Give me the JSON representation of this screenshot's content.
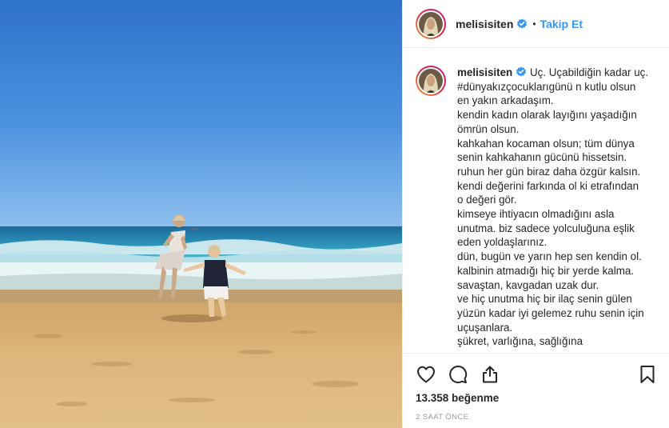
{
  "post": {
    "username": "melisisiten",
    "separator": "•",
    "follow_label": "Takip Et",
    "caption_lines": [
      "Uç. Uçabildiğin kadar uç.",
      "#dünyakızçocuklarıgünü n kutlu olsun",
      "en yakın arkadaşım.",
      "kendin kadın olarak layığını yaşadığın",
      "ömrün olsun.",
      "kahkahan kocaman olsun; tüm dünya",
      "senin kahkahanın gücünü hissetsin.",
      "ruhun her gün biraz daha özgür kalsın.",
      "kendi değerini farkında ol ki etrafından",
      "o değeri gör.",
      "kimseye ihtiyacın olmadığını asla",
      "unutma. biz sadece yolculuğuna eşlik",
      "eden yoldaşlarınız.",
      "dün, bugün ve yarın hep sen kendin ol.",
      "kalbinin atmadığı hiç bir yerde kalma.",
      "savaştan, kavgadan uzak dur.",
      "ve hiç unutma hiç bir ilaç senin gülen",
      "yüzün kadar iyi gelemez ruhu senin için",
      "uçuşanlara.",
      "şükret, varlığına, sağlığına"
    ],
    "likes": "13.358 beğenme",
    "timestamp": "2 SAAT ÖNCE"
  },
  "colors": {
    "accent": "#3897f0",
    "verified": "#3897f0",
    "text": "#262626",
    "muted": "#999999"
  },
  "icons": {
    "like": "heart-icon",
    "comment": "comment-icon",
    "share": "share-icon",
    "save": "bookmark-icon",
    "verified": "verified-badge-icon"
  }
}
